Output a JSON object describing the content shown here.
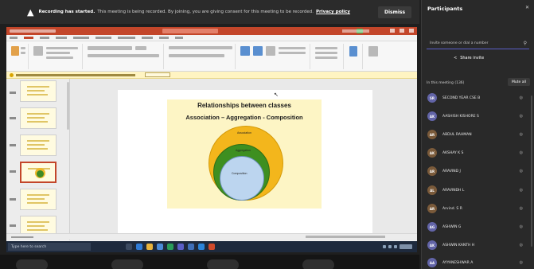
{
  "banner": {
    "title": "Recording has started.",
    "message": "This meeting is being recorded. By joining, you are giving consent for this meeting to be recorded.",
    "link": "Privacy policy",
    "dismiss": "Dismiss"
  },
  "slide": {
    "title": "Relationships between classes",
    "subtitle": "Association – Aggregation - Composition",
    "labels": {
      "association": "Association",
      "aggregation": "Aggregation",
      "composition": "Composition"
    }
  },
  "taskbar": {
    "search_placeholder": "Type here to search"
  },
  "panel": {
    "title": "Participants",
    "invite_placeholder": "Invite someone or dial a number",
    "share_invite": "Share invite",
    "section": "In this meeting (136)",
    "mute_all": "Mute all",
    "participants": [
      {
        "initials": "SR",
        "name": "SECOND YEAR CSE B"
      },
      {
        "initials": "AK",
        "name": "AASHISH KISHORE S"
      },
      {
        "initials": "AR",
        "name": "ABDUL RAHMAN"
      },
      {
        "initials": "AK",
        "name": "AKSHAY K S"
      },
      {
        "initials": "AR",
        "name": "ARAVIND J"
      },
      {
        "initials": "AL",
        "name": "ARAVINDH L"
      },
      {
        "initials": "AR",
        "name": "Arvind. S R"
      },
      {
        "initials": "AG",
        "name": "ASHWIN G"
      },
      {
        "initials": "AK",
        "name": "ASHWIN KANTH H"
      },
      {
        "initials": "AA",
        "name": "AYYANESHWAR A"
      }
    ]
  }
}
